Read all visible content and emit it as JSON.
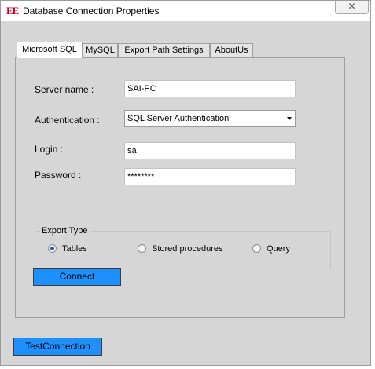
{
  "window": {
    "title": "Database Connection Properties",
    "icon": "EE",
    "close_label": "✕"
  },
  "tabs": [
    {
      "label": "Microsoft SQL",
      "active": true
    },
    {
      "label": "MySQL",
      "active": false
    },
    {
      "label": "Export Path Settings",
      "active": false
    },
    {
      "label": "AboutUs",
      "active": false
    }
  ],
  "form": {
    "server_label": "Server name :",
    "server_value": "SAI-PC",
    "auth_label": "Authentication :",
    "auth_value": "SQL Server Authentication",
    "login_label": "Login :",
    "login_value": "sa",
    "password_label": "Password :",
    "password_value": "********"
  },
  "export_type": {
    "legend": "Export Type",
    "options": [
      {
        "label": "Tables",
        "checked": true
      },
      {
        "label": "Stored procedures",
        "checked": false
      },
      {
        "label": "Query",
        "checked": false
      }
    ]
  },
  "buttons": {
    "connect": "Connect",
    "test_connection": "TestConnection"
  },
  "colors": {
    "button_blue": "#1e90ff",
    "window_bg": "#d6d6d6",
    "icon_red": "#c8001e"
  }
}
